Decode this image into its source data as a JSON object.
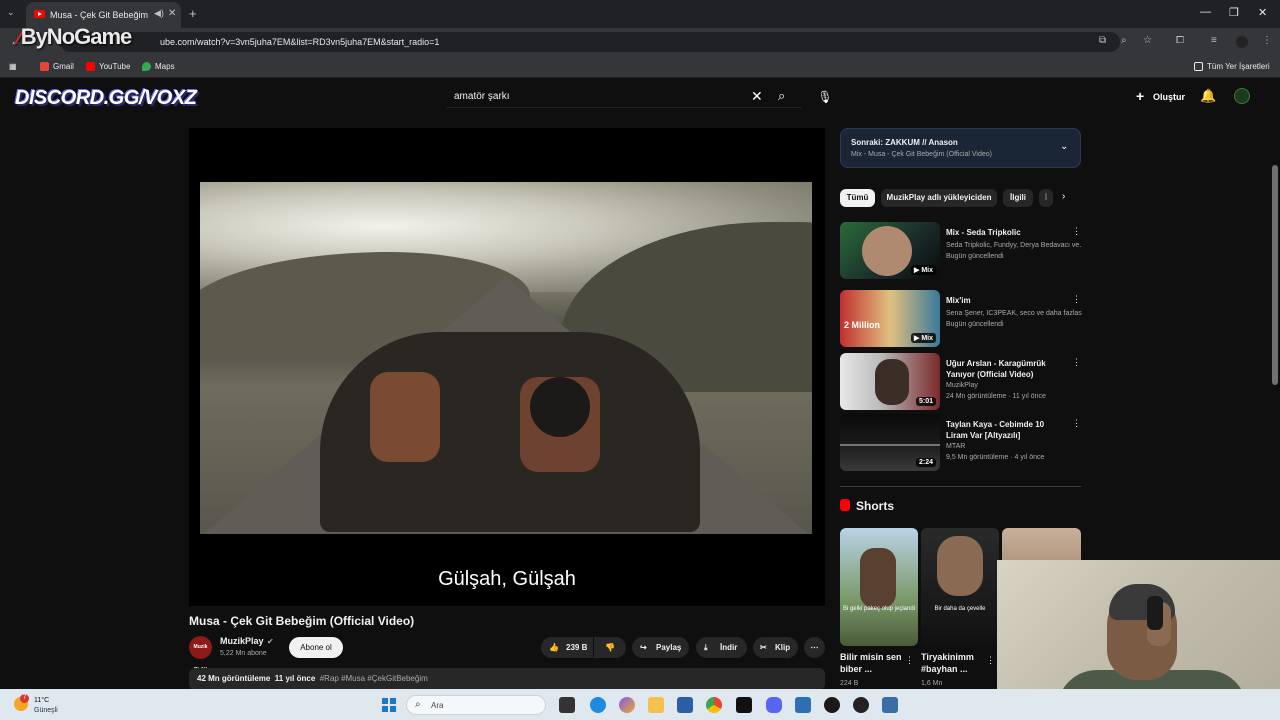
{
  "browser": {
    "tab_title": "Musa - Çek Git Bebeğim (O",
    "url": "ube.com/watch?v=3vn5juha7EM&list=RD3vn5juha7EM&start_radio=1",
    "overlay_logo": "ByNoGame",
    "bookmarks": [
      "Gmail",
      "YouTube",
      "Maps"
    ],
    "all_bookmarks": "Tüm Yer İşaretleri"
  },
  "youtube": {
    "overlay_banner": "DISCORD.GG/VOXZ",
    "search_query": "amatör şarkı",
    "create_label": "Oluştur"
  },
  "video": {
    "subtitle": "Gülşah, Gülşah",
    "title": "Musa - Çek Git Bebeğim (Official Video)",
    "channel": "MuzikPlay",
    "channel_avatar_text": "Muzik PLAY",
    "subscribers": "5,22 Mn abone",
    "subscribe_label": "Abone ol",
    "likes": "239 B",
    "share_label": "Paylaş",
    "download_label": "İndir",
    "clip_label": "Klip",
    "views": "42 Mn görüntüleme",
    "age": "11 yıl önce",
    "tags": "#Rap #Musa #ÇekGitBebeğim"
  },
  "up_next": {
    "title": "Sonraki: ZAKKUM // Anason",
    "subtitle": "Mix - Musa - Çek Git Bebeğim (Official Video)"
  },
  "chips": [
    "Tümü",
    "MuzikPlay adlı yükleyiciden",
    "İlgili",
    "İ"
  ],
  "recommendations": [
    {
      "title": "Mix - Seda Tripkolic",
      "meta1": "Seda Tripkolic, Fundyy, Derya Bedavacı ve...",
      "meta2": "Bugün güncellendi",
      "badge": "Mix"
    },
    {
      "title": "Mix'im",
      "meta1": "Sena Şener, IC3PEAK, seco ve daha fazlası",
      "meta2": "Bugün güncellendi",
      "badge": "Mix"
    },
    {
      "title": "Uğur Arslan - Karagümrük Yanıyor (Official Video)",
      "meta1": "MuzikPlay",
      "meta2": "24 Mn görüntüleme · 11 yıl önce",
      "badge": "5:01"
    },
    {
      "title": "Taylan Kaya - Cebimde 10 Liram Var [Altyazılı]",
      "meta1": "MTAR",
      "meta2": "9,5 Mn görüntüleme · 4 yıl önce",
      "badge": "2:24"
    }
  ],
  "shorts": {
    "header": "Shorts",
    "items": [
      {
        "title": "Bilir misin sen biber ...",
        "views": "224 B",
        "caption": "Bi gelki pakeç olup jeçlandi"
      },
      {
        "title": "Tiryakinimm #bayhan ...",
        "views": "1,6 Mn",
        "caption": "Bir daha da çevelle"
      }
    ]
  },
  "taskbar": {
    "temperature": "11°C",
    "weather": "Güneşli",
    "alert_count": "7",
    "search_label": "Ara"
  }
}
